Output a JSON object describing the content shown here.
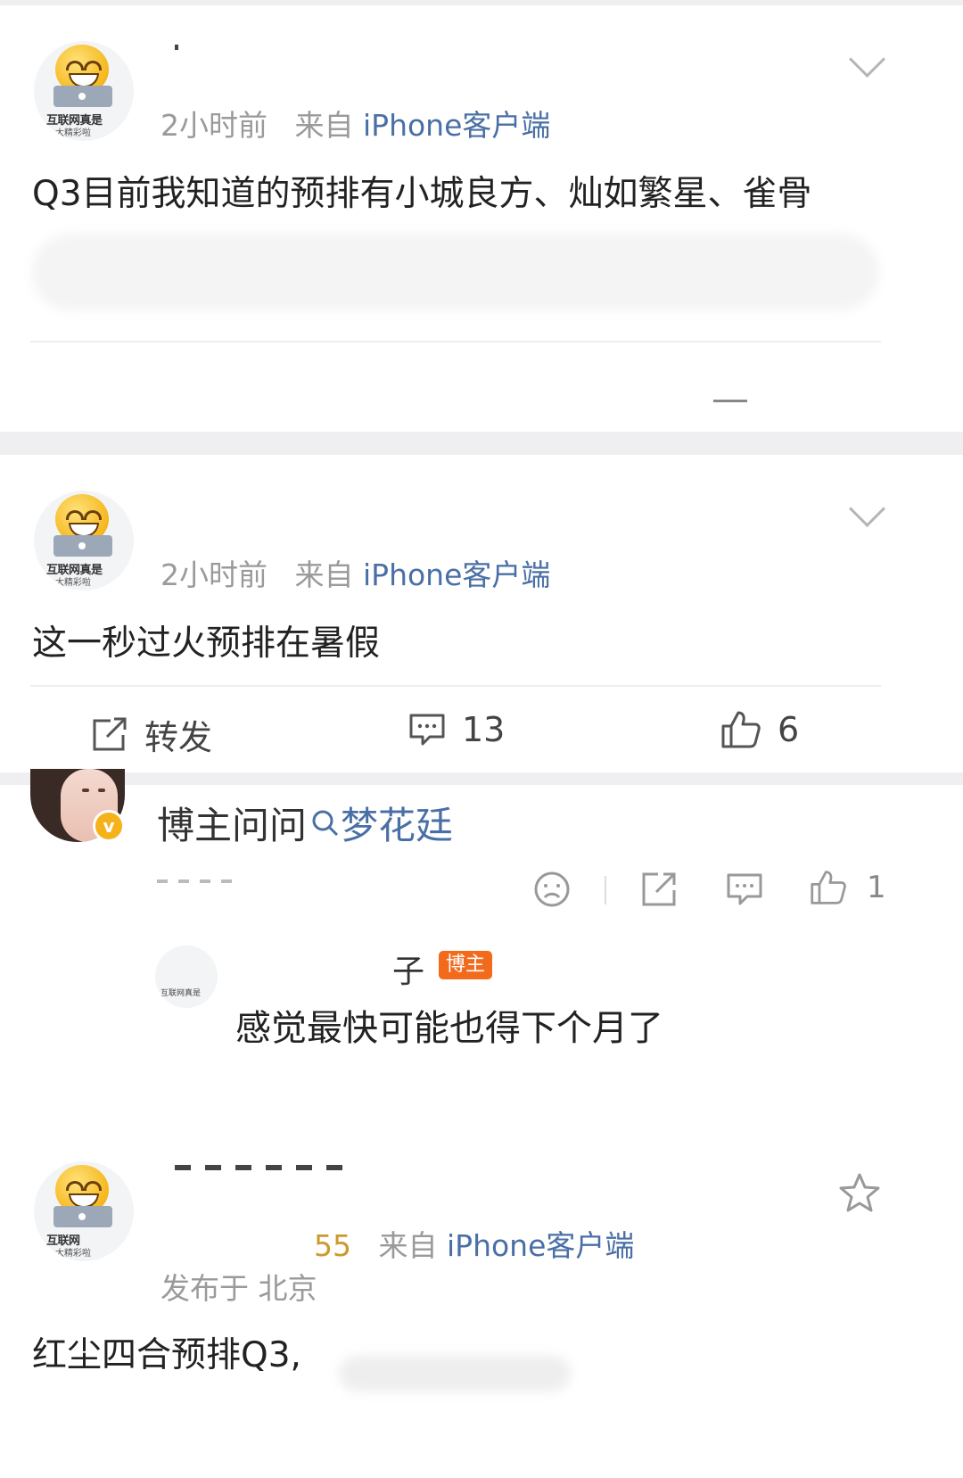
{
  "post1": {
    "avatar_caption": "互联网真是",
    "avatar_caption2": "大精彩啦",
    "time": "2小时前",
    "from_label": "来自",
    "source": "iPhone客户端",
    "text": "Q3目前我知道的预排有小城良方、灿如繁星、雀骨"
  },
  "post2": {
    "avatar_caption": "互联网真是",
    "avatar_caption2": "大精彩啦",
    "time": "2小时前",
    "from_label": "来自",
    "source": "iPhone客户端",
    "text": "这一秒过火预排在暑假",
    "actions": {
      "repost_label": "转发",
      "comment_count": "13",
      "like_count": "6"
    }
  },
  "reply": {
    "question_label": "博主问问",
    "search_term": "梦花廷",
    "like_count": "1",
    "sub_reply": {
      "author_suffix": "子",
      "badge": "博主",
      "text": "感觉最快可能也得下个月了"
    }
  },
  "post3": {
    "avatar_caption": "互联网",
    "avatar_caption2": "大精彩啦",
    "time": "55",
    "from_label": "来自",
    "source": "iPhone客户端",
    "location": "发布于 北京",
    "text": "红尘四合预排Q3,"
  },
  "colors": {
    "meta_gray": "#9a9a9a",
    "link_blue": "#4a6fa5",
    "badge_orange": "#f26b1d",
    "time_gold": "#c99a2e",
    "band_gray": "#efeff1"
  }
}
